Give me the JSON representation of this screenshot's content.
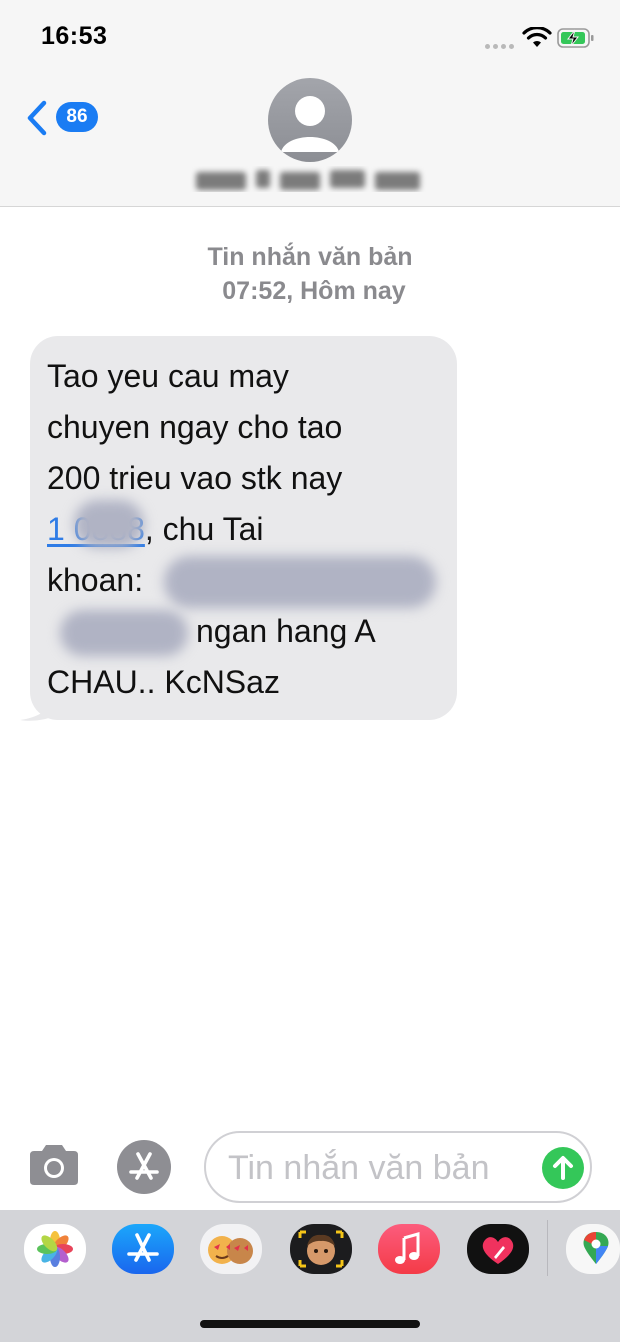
{
  "status_bar": {
    "time": "16:53",
    "battery_state": "charging",
    "icons": [
      "cellular-dots-icon",
      "wifi-icon",
      "battery-charging-icon"
    ]
  },
  "header": {
    "back_icon": "chevron-left-icon",
    "unread_count": "86",
    "avatar_icon": "person-silhouette-icon",
    "contact_name_redacted": true
  },
  "thread": {
    "meta_type": "Tin nhắn văn bản",
    "meta_time": "07:52, Hôm nay",
    "message": {
      "line1": "Tao yeu cau may",
      "line2": "chuyen ngay cho tao",
      "line3": "200 trieu vao stk nay",
      "line4_link": "1      0888",
      "line4_rest": ", chu Tai",
      "line5": "khoan:",
      "line6": "ngan hang A",
      "line7": "CHAU.. KcNSaz"
    }
  },
  "composer": {
    "camera_icon": "camera-icon",
    "apps_icon": "app-store-icon",
    "placeholder": "Tin nhắn văn bản",
    "send_icon": "send-arrow-up-icon"
  },
  "app_drawer": {
    "apps": [
      "photos-icon",
      "app-store-icon",
      "memoji-stickers-icon",
      "memoji-icon",
      "music-icon",
      "digital-touch-icon",
      "maps-icon"
    ]
  },
  "colors": {
    "accent_blue": "#1a7cf3",
    "bubble_gray": "#e9e9eb",
    "send_green": "#34c759",
    "link_blue": "#2f7ce6",
    "meta_gray": "#8a8a8e"
  }
}
